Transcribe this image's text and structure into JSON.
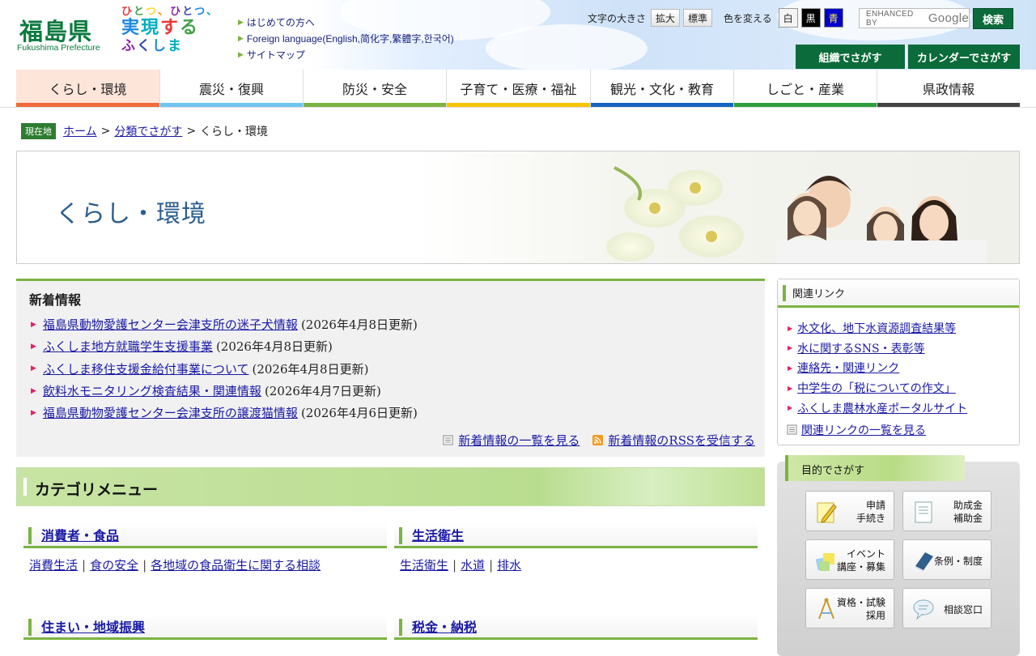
{
  "header": {
    "logo_main": "福島県",
    "logo_sub": "Fukushima Prefecture",
    "slogan_row1": [
      "ひ",
      "と",
      "つ",
      "、",
      "ひ",
      "と",
      "つ",
      "、"
    ],
    "slogan_row2": [
      "実",
      "現",
      "す",
      "る"
    ],
    "slogan_row3": [
      "ふ",
      "く",
      "し",
      "ま"
    ],
    "top_links": [
      "はじめての方へ",
      "Foreign language(English,简化字,繁體字,한국어)",
      "サイトマップ"
    ],
    "font_size_label": "文字の大きさ",
    "font_size_buttons": [
      "拡大",
      "標準"
    ],
    "color_label": "色を変える",
    "color_buttons": [
      "白",
      "黒",
      "青"
    ],
    "search_placeholder": "ENHANCED BY",
    "search_brand": "Google",
    "search_button": "検索",
    "org_button": "組織でさがす",
    "calendar_button": "カレンダーでさがす"
  },
  "nav": [
    {
      "label": "くらし・環境",
      "color": "#f06a3a"
    },
    {
      "label": "震災・復興",
      "color": "#6ec6f0"
    },
    {
      "label": "防災・安全",
      "color": "#7cb342"
    },
    {
      "label": "子育て・医療・福祉",
      "color": "#f5c400"
    },
    {
      "label": "観光・文化・教育",
      "color": "#1565c0"
    },
    {
      "label": "しごと・産業",
      "color": "#2e9e3e"
    },
    {
      "label": "県政情報",
      "color": "#444444"
    }
  ],
  "breadcrumb": {
    "tag": "現在地",
    "home": "ホーム",
    "category": "分類でさがす",
    "current": "くらし・環境",
    "sep": ">"
  },
  "banner": {
    "title": "くらし・環境"
  },
  "news": {
    "heading": "新着情報",
    "items": [
      {
        "title": "福島県動物愛護センター会津支所の迷子犬情報",
        "date": "(2026年4月8日更新)"
      },
      {
        "title": "ふくしま地方就職学生支援事業",
        "date": "(2026年4月8日更新)"
      },
      {
        "title": "ふくしま移住支援金給付事業について",
        "date": "(2026年4月8日更新)"
      },
      {
        "title": "飲料水モニタリング検査結果・関連情報",
        "date": "(2026年4月7日更新)"
      },
      {
        "title": "福島県動物愛護センター会津支所の譲渡猫情報",
        "date": "(2026年4月6日更新)"
      }
    ],
    "list_link": "新着情報の一覧を見る",
    "rss_link": "新着情報のRSSを受信する"
  },
  "category": {
    "heading": "カテゴリメニュー",
    "groups": [
      {
        "title": "消費者・食品",
        "links": [
          "消費生活",
          "食の安全",
          "各地域の食品衛生に関する相談"
        ]
      },
      {
        "title": "生活衛生",
        "links": [
          "生活衛生",
          "水道",
          "排水"
        ]
      },
      {
        "title": "住まい・地域振興",
        "links": []
      },
      {
        "title": "税金・納税",
        "links": []
      }
    ]
  },
  "related": {
    "heading": "関連リンク",
    "items": [
      "水文化、地下水資源調査結果等",
      "水に関するSNS・表彰等",
      "連絡先・関連リンク",
      "中学生の「税についての作文」",
      "ふくしま農林水産ポータルサイト"
    ],
    "more": "関連リンクの一覧を見る"
  },
  "purpose": {
    "heading": "目的でさがす",
    "buttons": [
      {
        "label": "申請\n手続き",
        "icon": "pencil-note-icon"
      },
      {
        "label": "助成金\n補助金",
        "icon": "document-icon"
      },
      {
        "label": "イベント\n講座・募集",
        "icon": "event-cards-icon"
      },
      {
        "label": "条例・制度",
        "icon": "book-icon"
      },
      {
        "label": "資格・試験\n採用",
        "icon": "compass-icon"
      },
      {
        "label": "相談窓口",
        "icon": "speech-bubble-icon"
      }
    ]
  }
}
